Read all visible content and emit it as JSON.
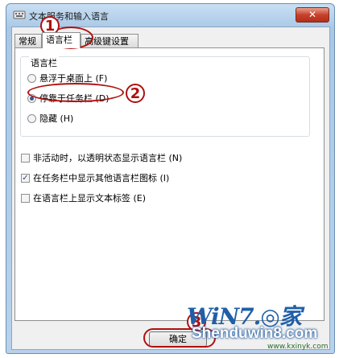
{
  "window": {
    "title": "文本服务和输入语言",
    "close_label": "✕"
  },
  "tabs": [
    {
      "label": "常规",
      "active": false
    },
    {
      "label": "语言栏",
      "active": true
    },
    {
      "label": "高级键设置",
      "active": false
    }
  ],
  "language_bar": {
    "group_label": "语言栏",
    "options": [
      {
        "label": "悬浮于桌面上 (F)",
        "checked": false
      },
      {
        "label": "停靠于任务栏 (D)",
        "checked": true
      },
      {
        "label": "隐藏 (H)",
        "checked": false
      }
    ]
  },
  "checkboxes": [
    {
      "label": "非活动时，以透明状态显示语言栏 (N)",
      "checked": false
    },
    {
      "label": "在任务栏中显示其他语言栏图标 (I)",
      "checked": true
    },
    {
      "label": "在语言栏上显示文本标签 (E)",
      "checked": false
    }
  ],
  "buttons": {
    "ok": "确定"
  },
  "annotations": {
    "step1": "1",
    "step2": "2",
    "step3": "3"
  },
  "watermark": {
    "logo": "WiN7.◎家",
    "site": "Shenduwin8.com",
    "url": "www.kxinyk.com"
  },
  "colors": {
    "annotation": "#b01010",
    "accent": "#2b5a9a"
  }
}
